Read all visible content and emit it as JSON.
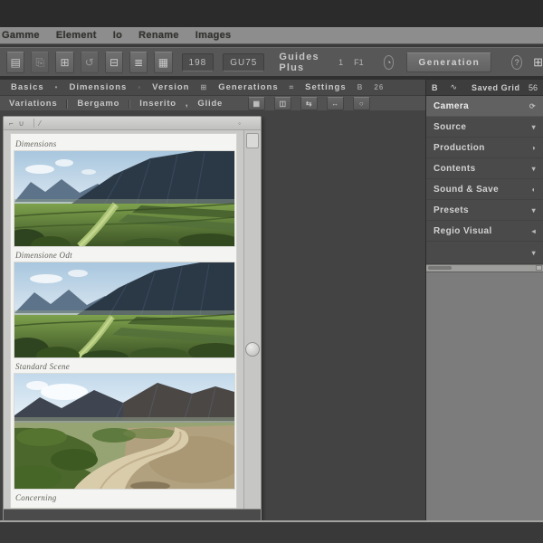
{
  "menu_bar": {
    "items": [
      "Gamme",
      "Element",
      "Io",
      "Rename",
      "Images"
    ]
  },
  "toolbar": {
    "buttons": [
      {
        "name": "new-document",
        "glyph": "▤"
      },
      {
        "name": "open-folder",
        "glyph": "⎘"
      },
      {
        "name": "save",
        "glyph": "⊞"
      },
      {
        "name": "undo",
        "glyph": "↺"
      },
      {
        "name": "export",
        "glyph": "⊟"
      },
      {
        "name": "layers",
        "glyph": "≣"
      },
      {
        "name": "grid-view",
        "glyph": "▦"
      }
    ],
    "zoom_field": "198",
    "unit_field": "GU75",
    "guides_label": "Guides Plus",
    "scale_label": "1",
    "fn_label": "F1",
    "sync_icon_glyph": "◔",
    "generation_button": "Generation",
    "help_button": "?",
    "panel_grid_glyph": "⊞"
  },
  "tabs_row": {
    "tabs": [
      "Basics",
      "Dimensions",
      "Version",
      "Generations",
      "Settings"
    ],
    "separators": [
      "•",
      "◦",
      "⊞",
      "⌗"
    ],
    "badge_b": "B",
    "badge_count": "26"
  },
  "options_row": {
    "items": [
      "Variations",
      "Bergamo",
      "Inserito",
      "Glide"
    ],
    "comma": ",",
    "tool_icons": [
      {
        "name": "thumbnail-grid",
        "glyph": "▦"
      },
      {
        "name": "split-view",
        "glyph": "◫"
      },
      {
        "name": "swap-arrows",
        "glyph": "⇆"
      },
      {
        "name": "fit-width",
        "glyph": "↔"
      },
      {
        "name": "refresh-circle",
        "glyph": "○"
      }
    ]
  },
  "right_panel": {
    "header": {
      "left_icon": "B",
      "wave_icon": "∿",
      "title": "Saved Grid",
      "count": "56"
    },
    "items": [
      {
        "label": "Camera",
        "glyph": "⟳",
        "selected": true
      },
      {
        "label": "Source",
        "glyph": "▾"
      },
      {
        "label": "Production",
        "glyph": "◑"
      },
      {
        "label": "Contents",
        "glyph": "▾"
      },
      {
        "label": "Sound & Save",
        "glyph": "◖"
      },
      {
        "label": "Presets",
        "glyph": "▾"
      },
      {
        "label": "Regio Visual",
        "glyph": "◂"
      }
    ],
    "footer_glyph": "▾"
  },
  "document": {
    "captions": [
      "Dimensions",
      "Dimensione Odt",
      "Standard Scene",
      "Concerning"
    ]
  },
  "palette": {
    "sky": "#aac7de",
    "mountain_dark": "#2b3947",
    "mountain_far": "#5d7389",
    "field_green": "#5f7d38",
    "field_dark": "#3c5226",
    "road_tan": "#d8cbae",
    "dry_grass": "#b0a07e",
    "canvas": "#434343",
    "panel_bg": "#4a4a4a",
    "panel_light": "#7c7c7c",
    "page": "#f4f4f2",
    "menubar": "#8d8d8d"
  }
}
